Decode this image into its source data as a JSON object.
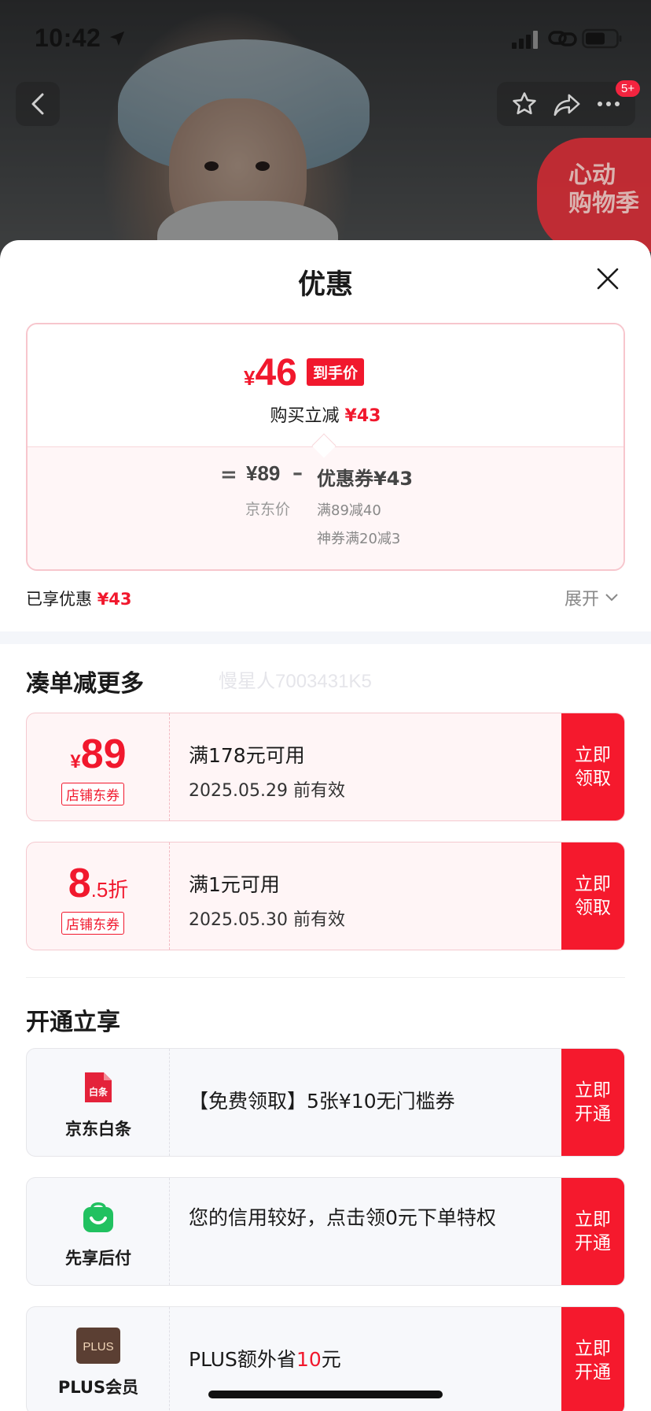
{
  "status_bar": {
    "time": "10:42"
  },
  "top_nav": {
    "badge": "5+",
    "promo_line1": "心动",
    "promo_line2": "购物季"
  },
  "sheet": {
    "title": "优惠",
    "price_card": {
      "yen": "¥",
      "final_price": "46",
      "final_price_tag": "到手价",
      "instant_label": "购买立减",
      "instant_value": "¥43",
      "equals": "=",
      "jd_price": "¥89",
      "jd_price_label": "京东价",
      "minus": "–",
      "coupon_total": "优惠券¥43",
      "coupon_rule_1": "满89减40",
      "coupon_rule_2": "神券满20减3"
    },
    "enjoyed_label": "已享优惠",
    "enjoyed_value": "¥43",
    "expand_label": "展开",
    "watermark": "慢星人7003431K5",
    "coupon_section": {
      "title": "凑单减更多",
      "coupons": [
        {
          "yen": "¥",
          "amount": "89",
          "suffix": "",
          "tag": "店铺东券",
          "condition": "满178元可用",
          "valid": "2025.05.29 前有效",
          "action": "立即领取"
        },
        {
          "yen": "",
          "amount": "8",
          "suffix": ".5折",
          "tag": "店铺东券",
          "condition": "满1元可用",
          "valid": "2025.05.30 前有效",
          "action": "立即领取"
        }
      ]
    },
    "service_section": {
      "title": "开通立享",
      "services": [
        {
          "name": "京东白条",
          "logo_text": "白条",
          "desc": "【免费领取】5张¥10无门槛券",
          "action": "立即开通"
        },
        {
          "name": "先享后付",
          "desc": "您的信用较好，点击领0元下单特权",
          "action": "立即开通"
        },
        {
          "name": "PLUS会员",
          "logo_text": "PLUS",
          "desc_prefix": "PLUS额外省",
          "desc_highlight": "10",
          "desc_suffix": "元",
          "action": "立即开通"
        }
      ]
    }
  },
  "colors": {
    "accent_red": "#f1182d",
    "button_red": "#f5192d",
    "sheet_bg": "#ffffff",
    "baitiao_red": "#e4223a",
    "xianxiang_green": "#21c160",
    "plus_brown": "#5b3f33"
  }
}
